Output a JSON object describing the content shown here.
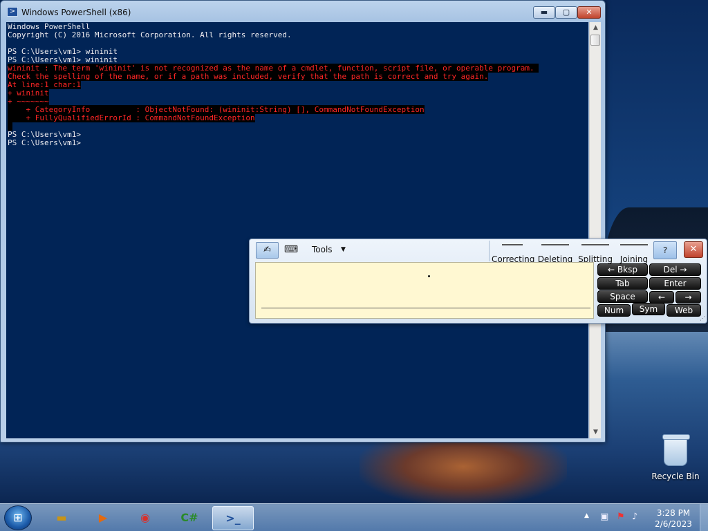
{
  "window": {
    "title": "Windows PowerShell (x86)",
    "minimize_glyph": "▬",
    "maximize_glyph": "▢",
    "close_glyph": "✕"
  },
  "console": {
    "lines": [
      {
        "text": "Windows PowerShell",
        "type": "normal"
      },
      {
        "text": "Copyright (C) 2016 Microsoft Corporation. All rights reserved.",
        "type": "normal"
      },
      {
        "text": "",
        "type": "gap"
      },
      {
        "text": "PS C:\\Users\\vm1> wininit",
        "type": "normal"
      },
      {
        "text": "PS C:\\Users\\vm1> wininit",
        "type": "normal"
      },
      {
        "text": "wininit : The term 'wininit' is not recognized as the name of a cmdlet, function, script file, or operable program. ",
        "type": "error"
      },
      {
        "text": "Check the spelling of the name, or if a path was included, verify that the path is correct and try again.",
        "type": "error"
      },
      {
        "text": "At line:1 char:1",
        "type": "error"
      },
      {
        "text": "+ wininit",
        "type": "error"
      },
      {
        "text": "+ ~~~~~~~",
        "type": "error"
      },
      {
        "text": "    + CategoryInfo          : ObjectNotFound: (wininit:String) [], CommandNotFoundException",
        "type": "error"
      },
      {
        "text": "    + FullyQualifiedErrorId : CommandNotFoundException",
        "type": "error"
      },
      {
        "text": "",
        "type": "error-blank"
      },
      {
        "text": "PS C:\\Users\\vm1>",
        "type": "normal"
      },
      {
        "text": "PS C:\\Users\\vm1>",
        "type": "normal"
      }
    ]
  },
  "tip": {
    "tools_label": "Tools",
    "gestures": [
      "Correcting",
      "Deleting",
      "Splitting",
      "Joining"
    ],
    "help_glyph": "?",
    "close_glyph": "✕",
    "keys": {
      "bksp": "←   Bksp",
      "del": "Del    →",
      "tab": "Tab",
      "enter": "Enter",
      "space": "Space",
      "left": "←",
      "right": "→",
      "num": "Num",
      "sym": "Sym",
      "web": "Web"
    }
  },
  "desktop": {
    "recycle_bin_label": "Recycle Bin"
  },
  "taskbar": {
    "clock_time": "3:28 PM",
    "clock_date": "2/6/2023",
    "csharp_glyph": "C#",
    "ps_glyph": ">_"
  }
}
